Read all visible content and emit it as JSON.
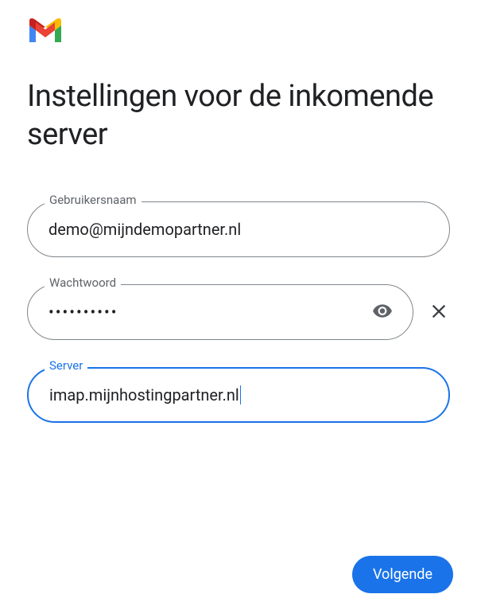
{
  "title": "Instellingen voor de inkomende server",
  "fields": {
    "username": {
      "label": "Gebruikersnaam",
      "value": "demo@mijndemopartner.nl"
    },
    "password": {
      "label": "Wachtwoord",
      "value": "••••••••••"
    },
    "server": {
      "label": "Server",
      "value": "imap.mijnhostingpartner.nl"
    }
  },
  "buttons": {
    "next": "Volgende"
  },
  "colors": {
    "primary": "#1a73e8",
    "border": "#80868b",
    "text": "#202124",
    "label": "#5f6368"
  }
}
